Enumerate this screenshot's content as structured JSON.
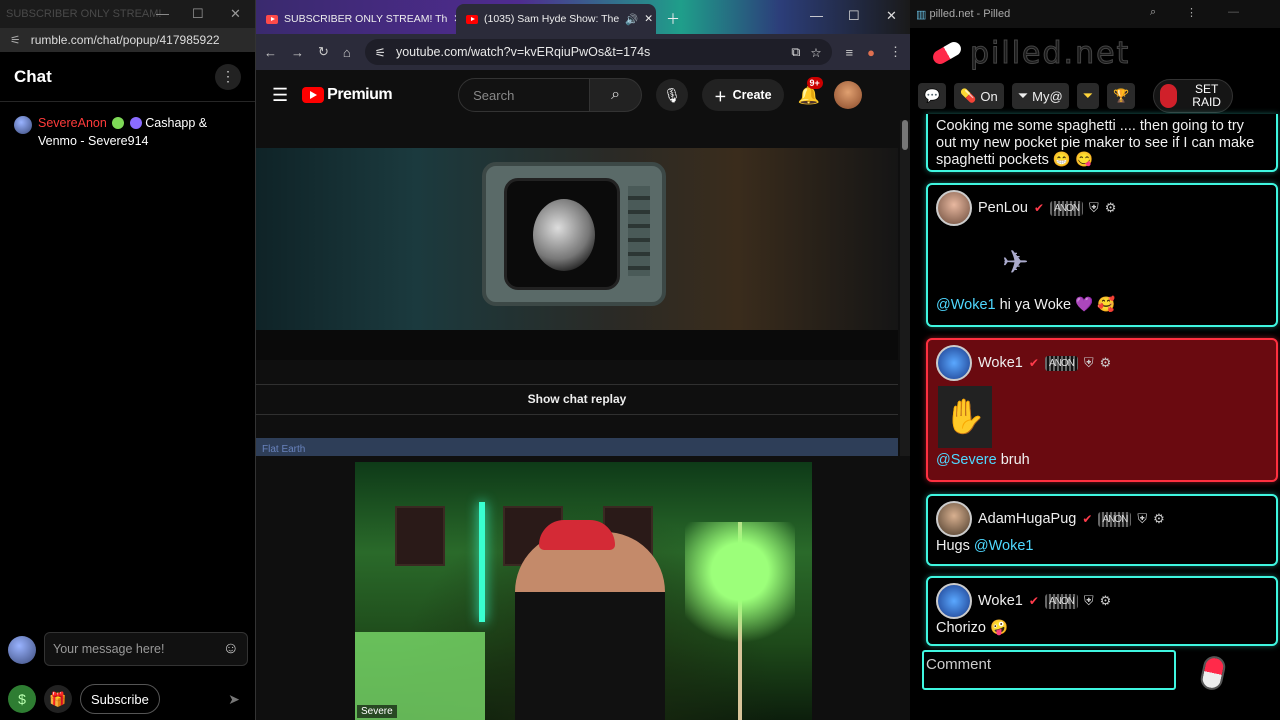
{
  "left": {
    "tab_title": "SUBSCRIBER ONLY STREAM!",
    "url": "rumble.com/chat/popup/417985922",
    "chat_title": "Chat",
    "message": {
      "user": "SevereAnon",
      "text": "Cashapp & Venmo - Severe914"
    },
    "input_placeholder": "Your message here!",
    "subscribe_label": "Subscribe",
    "colors": {
      "username": "#ff3b3b",
      "dollar": "#4caf50"
    }
  },
  "mid": {
    "tabs": [
      {
        "label": "SUBSCRIBER ONLY STREAM! Th"
      },
      {
        "label": "(1035) Sam Hyde Show: The"
      }
    ],
    "url": "youtube.com/watch?v=kvERqiuPwOs&t=174s",
    "logo_label": "Premium",
    "search_placeholder": "Search",
    "create_label": "Create",
    "notif_count": "9+",
    "show_chat_replay": "Show chat replay",
    "band_text": "Flat Earth",
    "cam_tag": "Severe",
    "colors": {
      "brand": "#ff0000"
    }
  },
  "right": {
    "window_title": "pilled.net - Pilled",
    "logo": "pilled.net",
    "toolbar": {
      "on_label": "On",
      "my_label": "My@",
      "raid_label": "SET RAID"
    },
    "first_message": "Cooking me some spaghetti .... then going to try out my new pocket pie maker to see if I can make spaghetti pockets 😁 😋",
    "messages": [
      {
        "user": "PenLou",
        "mention": "@Woke1",
        "text": " hi ya Woke 💜 🥰"
      },
      {
        "user": "Woke1",
        "mention": "@Severe",
        "text": " bruh"
      },
      {
        "user": "AdamHugaPug",
        "prefix": "Hugs ",
        "mention": "@Woke1",
        "text": ""
      },
      {
        "user": "Woke1",
        "text": "Chorizo 🤪"
      }
    ],
    "rank_badge": "ANON",
    "comment_placeholder": "Comment",
    "colors": {
      "card_border": "#3ff6e0",
      "highlight": "#6a0a10",
      "mention": "#4fd8ff"
    }
  }
}
